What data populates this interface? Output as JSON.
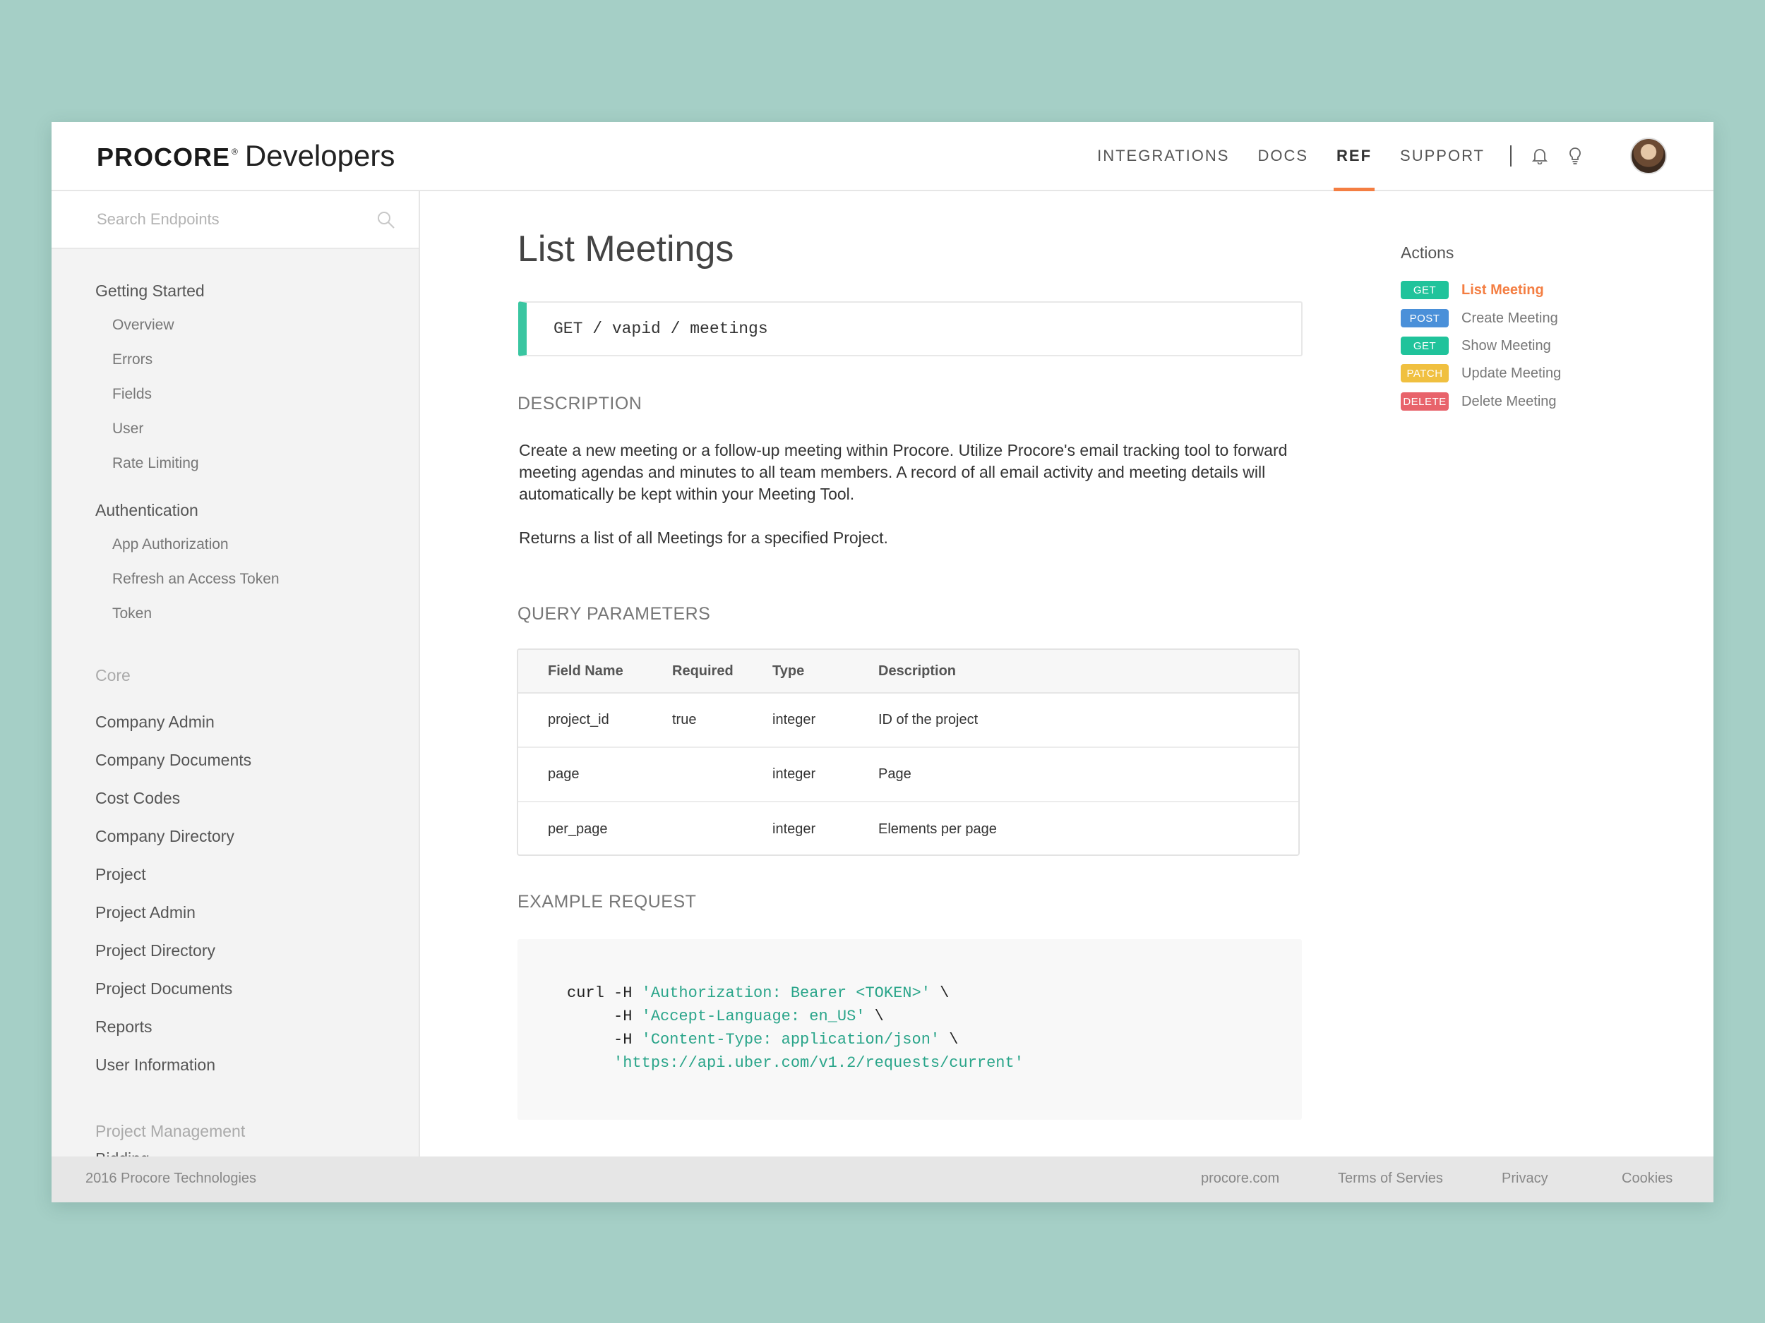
{
  "header": {
    "brand": "PROCORE",
    "brand_reg": "®",
    "product": "Developers",
    "nav": [
      "INTEGRATIONS",
      "DOCS",
      "REF",
      "SUPPORT"
    ],
    "active_nav": "REF",
    "accent_color": "#f47e42"
  },
  "sidebar": {
    "search_placeholder": "Search Endpoints",
    "getting_started": {
      "label": "Getting Started",
      "items": [
        "Overview",
        "Errors",
        "Fields",
        "User",
        "Rate Limiting"
      ]
    },
    "authentication": {
      "label": "Authentication",
      "items": [
        "App Authorization",
        "Refresh an Access Token",
        "Token"
      ]
    },
    "core": {
      "label": "Core",
      "items": [
        "Company Admin",
        "Company Documents",
        "Cost Codes",
        "Company Directory",
        "Project",
        "Project Admin",
        "Project Directory",
        "Project Documents",
        "Reports",
        "User Information"
      ]
    },
    "project_management": {
      "label": "Project Management",
      "items": [
        "Bidding"
      ]
    }
  },
  "main": {
    "title": "List Meetings",
    "endpoint": "GET / vapid / meetings",
    "description_heading": "DESCRIPTION",
    "description": "Create a new meeting or a follow-up meeting within Procore. Utilize Procore's email tracking tool to forward meeting agendas and minutes to all team members. A record of all email activity and meeting details will automatically be kept within your Meeting Tool.",
    "returns": "Returns a list of all Meetings for a specified Project.",
    "query_heading": "QUERY PARAMETERS",
    "table": {
      "columns": [
        "Field Name",
        "Required",
        "Type",
        "Description"
      ],
      "rows": [
        [
          "project_id",
          "true",
          "integer",
          "ID of the project"
        ],
        [
          "page",
          "",
          "integer",
          "Page"
        ],
        [
          "per_page",
          "",
          "integer",
          "Elements per page"
        ]
      ]
    },
    "example_heading": "EXAMPLE REQUEST",
    "example": {
      "l1_cmd": "curl -H ",
      "l1_str": "'Authorization: Bearer <TOKEN>'",
      "l2_cmd": "     -H ",
      "l2_str": "'Accept-Language: en_US'",
      "l3_cmd": "     -H ",
      "l3_str": "'Content-Type: application/json'",
      "cont": " \\",
      "l4_str": "'https://api.uber.com/v1.2/requests/current'"
    }
  },
  "actions": {
    "title": "Actions",
    "items": [
      {
        "method": "GET",
        "label": "List Meeting",
        "color": "#20c39b"
      },
      {
        "method": "POST",
        "label": "Create Meeting",
        "color": "#4a90d9"
      },
      {
        "method": "GET",
        "label": "Show Meeting",
        "color": "#20c39b"
      },
      {
        "method": "PATCH",
        "label": "Update Meeting",
        "color": "#f0c040"
      },
      {
        "method": "DELETE",
        "label": "Delete Meeting",
        "color": "#e8636b"
      }
    ],
    "active": "List Meeting"
  },
  "footer": {
    "copyright": "2016 Procore Technologies",
    "links": [
      "procore.com",
      "Terms of Servies",
      "Privacy",
      "Cookies"
    ]
  }
}
